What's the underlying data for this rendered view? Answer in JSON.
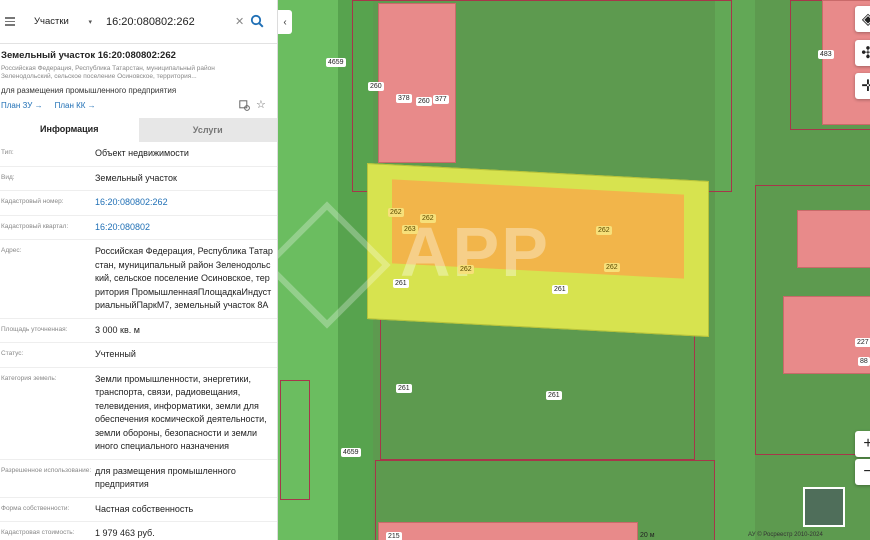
{
  "search": {
    "category": "Участки",
    "query": "16:20:080802:262"
  },
  "object": {
    "title": "Земельный участок 16:20:080802:262",
    "address_short": "Российская Федерация, Республика Татарстан, муниципальный район Зеленодольский, сельское поселение Осиновское, территория...",
    "purpose": "для размещения промышленного предприятия",
    "plan_zu": "План ЗУ",
    "plan_kk": "План КК"
  },
  "tabs": [
    "Информация",
    "Услуги"
  ],
  "info_rows": [
    {
      "key": "Тип:",
      "value": "Объект недвижимости"
    },
    {
      "key": "Вид:",
      "value": "Земельный участок"
    },
    {
      "key": "Кадастровый номер:",
      "value": "16:20:080802:262"
    },
    {
      "key": "Кадастровый квартал:",
      "value": "16:20:080802"
    },
    {
      "key": "Адрес:",
      "value": "Российская Федерация, Республика Татарстан, муниципальный район Зеленодольский, сельское поселение Осиновское, территория ПромышленнаяПлощадкаИндустриальныйПаркМ7, земельный участок 8А"
    },
    {
      "key": "Площадь уточненная:",
      "value": "3 000 кв. м"
    },
    {
      "key": "Статус:",
      "value": "Учтенный"
    },
    {
      "key": "Категория земель:",
      "value": "Земли промышленности, энергетики, транспорта, связи, радиовещания, телевидения, информатики, земли для обеспечения космической деятельности, земли обороны, безопасности и земли иного специального назначения"
    },
    {
      "key": "Разрешенное использование:",
      "value": "для размещения промышленного предприятия"
    },
    {
      "key": "Форма собственности:",
      "value": "Частная собственность"
    },
    {
      "key": "Кадастровая стоимость:",
      "value": "1 979 463 руб."
    }
  ],
  "map": {
    "watermark": "APP",
    "scale": "20 м",
    "copyright": "АУ © Росреестр 2010-2024",
    "labels": [
      "4659",
      "260",
      "378",
      "260",
      "377",
      "262",
      "262",
      "263",
      "262",
      "262",
      "262",
      "261",
      "261",
      "261",
      "261",
      "4659",
      "483",
      "227",
      "88",
      "215"
    ]
  },
  "colors": {
    "link": "#1f6fb5",
    "plot_highlight": "#e2e45a",
    "plot_inner": "#f0b24a",
    "building": "#e88a8a",
    "land": "#5d9a4f"
  }
}
